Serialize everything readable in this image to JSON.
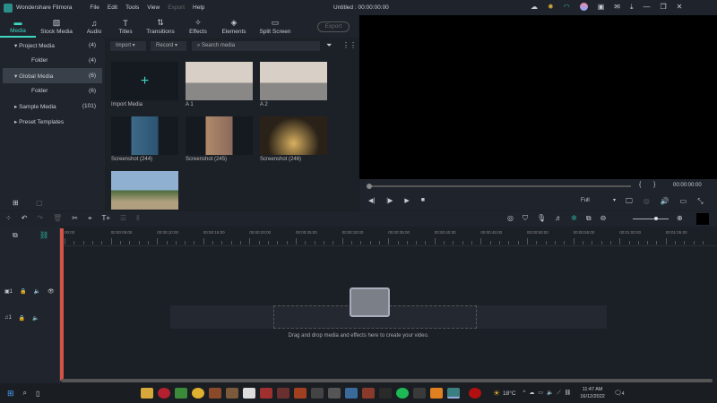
{
  "app": {
    "title": "Wondershare Filmora",
    "doc_title": "Untitled : 00:00:00:00"
  },
  "menu": [
    "File",
    "Edit",
    "Tools",
    "View",
    "Export",
    "Help"
  ],
  "tabs": [
    {
      "label": "Media",
      "icon": "folder-icon"
    },
    {
      "label": "Stock Media",
      "icon": "image-icon"
    },
    {
      "label": "Audio",
      "icon": "music-icon"
    },
    {
      "label": "Titles",
      "icon": "text-icon"
    },
    {
      "label": "Transitions",
      "icon": "transition-icon"
    },
    {
      "label": "Effects",
      "icon": "effects-icon"
    },
    {
      "label": "Elements",
      "icon": "elements-icon"
    },
    {
      "label": "Split Screen",
      "icon": "split-screen-icon"
    }
  ],
  "export_label": "Export",
  "sidebar": [
    {
      "label": "Project Media",
      "count": "(4)"
    },
    {
      "label": "Folder",
      "count": "(4)"
    },
    {
      "label": "Global Media",
      "count": "(6)"
    },
    {
      "label": "Folder",
      "count": "(6)"
    },
    {
      "label": "Sample Media",
      "count": "(101)"
    },
    {
      "label": "Preset Templates",
      "count": ""
    }
  ],
  "toolbar": {
    "import": "Import",
    "record": "Record",
    "search_placeholder": "Search media"
  },
  "media": [
    {
      "label": "Import Media"
    },
    {
      "label": "A 1"
    },
    {
      "label": "A 2"
    },
    {
      "label": "Screenshot (244)"
    },
    {
      "label": "Screenshot (245)"
    },
    {
      "label": "Screenshot (246)"
    },
    {
      "label": ""
    }
  ],
  "player": {
    "timecode": "00:00:00:00",
    "quality": "Full",
    "progress": 0
  },
  "ruler": [
    "00:00",
    "00:00:05:00",
    "00:00:10:00",
    "00:00:15:00",
    "00:00:20:00",
    "00:00:25:00",
    "00:00:30:00",
    "00:00:35:00",
    "00:00:40:00",
    "00:00:45:00",
    "00:00:50:00",
    "00:00:55:00",
    "00:01:00:00",
    "00:01:05:00"
  ],
  "timeline": {
    "drop_hint": "Drag and drop media and effects here to create your video.",
    "zoom": 0.6,
    "track_video": "1",
    "track_audio": "1"
  },
  "taskbar": {
    "weather": "18°C",
    "time": "11:47 AM",
    "date": "16/12/2022",
    "notifications": "4"
  }
}
